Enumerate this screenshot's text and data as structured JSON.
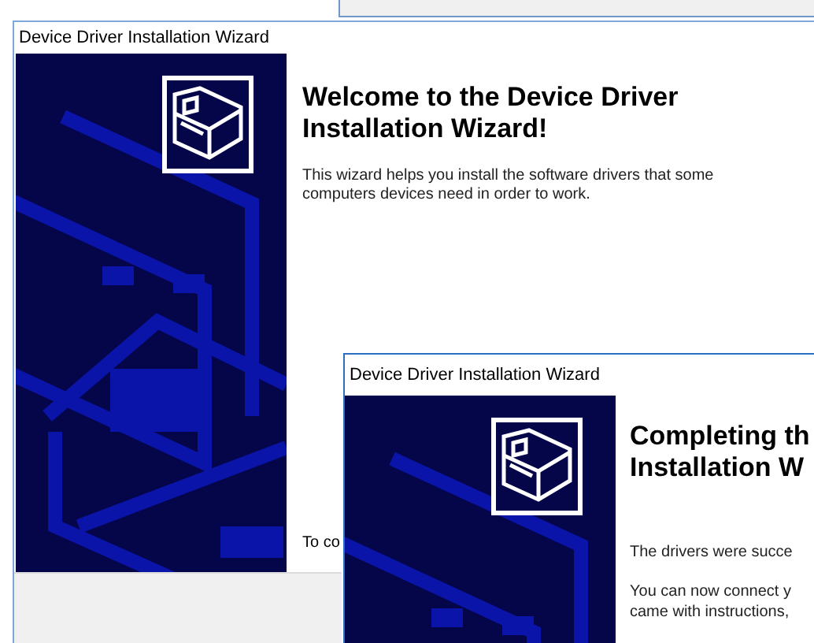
{
  "welcome_window": {
    "title": "Device Driver Installation Wizard",
    "heading": "Welcome to the Device Driver Installation Wizard!",
    "description": "This wizard helps you install the software drivers that some computers devices need in order to work.",
    "footer_text": "To co"
  },
  "completing_window": {
    "title": "Device Driver Installation Wizard",
    "heading_lines": [
      "Completing th",
      "Installation W"
    ],
    "status": "The drivers were succe",
    "note_lines": [
      "You can now connect y",
      "came with instructions, "
    ]
  }
}
